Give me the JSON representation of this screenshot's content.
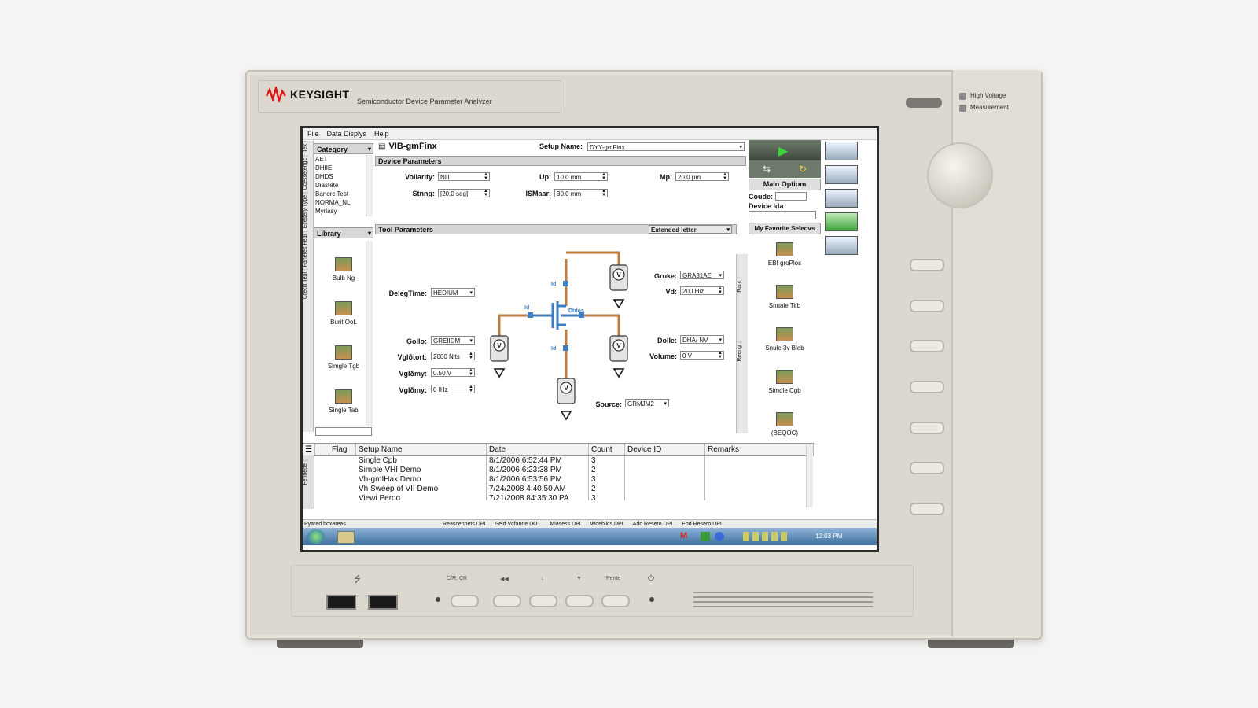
{
  "device": {
    "brand": "KEYSIGHT",
    "model": "Semiconductor Device Parameter Analyzer",
    "indicators": [
      "High Voltage",
      "Measurement"
    ],
    "panel_labels": [
      "C/R, CR",
      "◀◀",
      "↓",
      "▼",
      "Pente"
    ]
  },
  "menu": [
    "File",
    "Data Displys",
    "Help"
  ],
  "vtabs": [
    "Tex",
    "Ccesseterigc",
    "Ecesery Type",
    "Faneres Feal",
    "Crecili Teal"
  ],
  "sidebar": {
    "category_label": "Category",
    "tree": [
      "AET",
      "DHIIE",
      "DHDS",
      "Diastete",
      "Banorc Test",
      "NORMA_NL",
      "Myriasy"
    ],
    "library_label": "Library",
    "library_items": [
      "Bulb Ng",
      "Burit OoL",
      "Simgle Tgb",
      "Single Tab"
    ]
  },
  "header": {
    "setup_icon": "document-icon",
    "setup_title": "VIB-gmFinx",
    "setup_name_label": "Setup Name:",
    "setup_name_value": "DYY-gmFinx"
  },
  "device_params": {
    "title": "Device Parameters",
    "fields": [
      {
        "label": "Vollarity:",
        "value": "NIT"
      },
      {
        "label": "Stnng:",
        "value": "[20.0 seg]"
      },
      {
        "label": "Up:",
        "value": "10.0 mm"
      },
      {
        "label": "ISMaar:",
        "value": "30.0 mm"
      },
      {
        "label": "Mp:",
        "value": "20.0 μm"
      }
    ]
  },
  "tool_params": {
    "title": "Tool Parameters",
    "mode": "Extended letter",
    "left_fields": [
      {
        "label": "DelegTime:",
        "value": "HEDIUM"
      },
      {
        "label": "Gollo:",
        "value": "GREIIDM"
      },
      {
        "label": "Vglδtort:",
        "value": "2000 Nits"
      },
      {
        "label": "Vglδmy:",
        "value": "0.50 V"
      },
      {
        "label": "Vglδmy:",
        "value": "0 IHz"
      }
    ],
    "right_fields": [
      {
        "label": "Groke:",
        "value": "GRA31AE"
      },
      {
        "label": "Vd:",
        "value": "200 Hiz"
      },
      {
        "label": "Dolle:",
        "value": "DHA/ NV"
      },
      {
        "label": "Volume:",
        "value": "0 V"
      }
    ],
    "source_label": "Source:",
    "source_value": "GRMJM2",
    "diagram_labels": [
      "Id",
      "Id",
      "Id",
      "Dtdos",
      "V"
    ],
    "side_tabs": [
      "Rant",
      "Reeng"
    ]
  },
  "right_panel": {
    "main_option": "Main Optiom",
    "code_label": "Coude:",
    "device_ida": "Device Ida",
    "favorites": "My Favorite Seleovs",
    "items": [
      "EBI groPlos",
      "Snuale Tirb",
      "Snule 3v Bleb",
      "Simdle Cgb",
      "(BEQOC)"
    ]
  },
  "table": {
    "columns": [
      "Flag",
      "Setup Name",
      "Date",
      "Count",
      "Device ID",
      "Remarks"
    ],
    "rows": [
      {
        "name": "Single Cpb",
        "date": "8/1/2006 6:52:44 PM",
        "count": "3"
      },
      {
        "name": "Simple VHI Demo",
        "date": "8/1/2006 6:23:38 PM",
        "count": "2"
      },
      {
        "name": "Vh-gmIHax Demo",
        "date": "8/1/2006 6:53:56 PM",
        "count": "3"
      },
      {
        "name": "Vh Sweep of VII Demo",
        "date": "7/24/2008 4:40:50 AM",
        "count": "2"
      },
      {
        "name": "Viewi Perog",
        "date": "7/21/2008 84:35:30 PA",
        "count": "3"
      }
    ],
    "side_tab": "Fenriede"
  },
  "statusbar": {
    "text": "Pyared boxareas",
    "buttons": [
      "Reascennets DPI",
      "Seid Vcfanne DO1",
      "Miasess DPI",
      "Woeblics DPI",
      "Add Resero DPI",
      "Eod Resero DPI"
    ]
  },
  "taskbar": {
    "clock": "12:03 PM"
  }
}
